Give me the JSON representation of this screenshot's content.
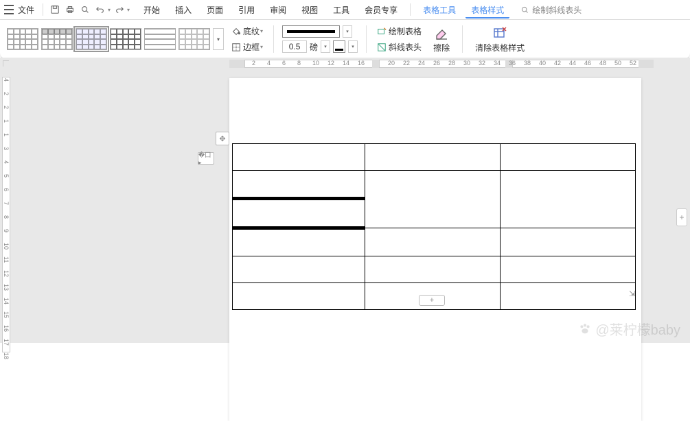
{
  "menubar": {
    "file_label": "文件",
    "tabs": [
      "开始",
      "插入",
      "页面",
      "引用",
      "审阅",
      "视图",
      "工具",
      "会员专享"
    ],
    "context_tabs": [
      "表格工具",
      "表格样式"
    ],
    "active_tab": "表格样式",
    "search_placeholder": "绘制斜线表头"
  },
  "ribbon": {
    "shading": "底纹",
    "border": "边框",
    "line_weight": "0.5",
    "line_unit": "磅",
    "draw_table": "绘制表格",
    "diag_header": "斜线表头",
    "eraser": "擦除",
    "clear_style": "清除表格样式"
  },
  "ruler_h": [
    2,
    4,
    6,
    8,
    10,
    12,
    14,
    16,
    20,
    22,
    24,
    26,
    28,
    30,
    32,
    34,
    36,
    38,
    40,
    42,
    44,
    46,
    48,
    50,
    52
  ],
  "ruler_v": [
    4,
    2,
    2,
    1,
    1,
    3,
    4,
    5,
    6,
    7,
    8,
    9,
    10,
    11,
    12,
    13,
    14,
    15,
    16,
    17,
    18
  ],
  "watermark": "@莱柠檬baby"
}
